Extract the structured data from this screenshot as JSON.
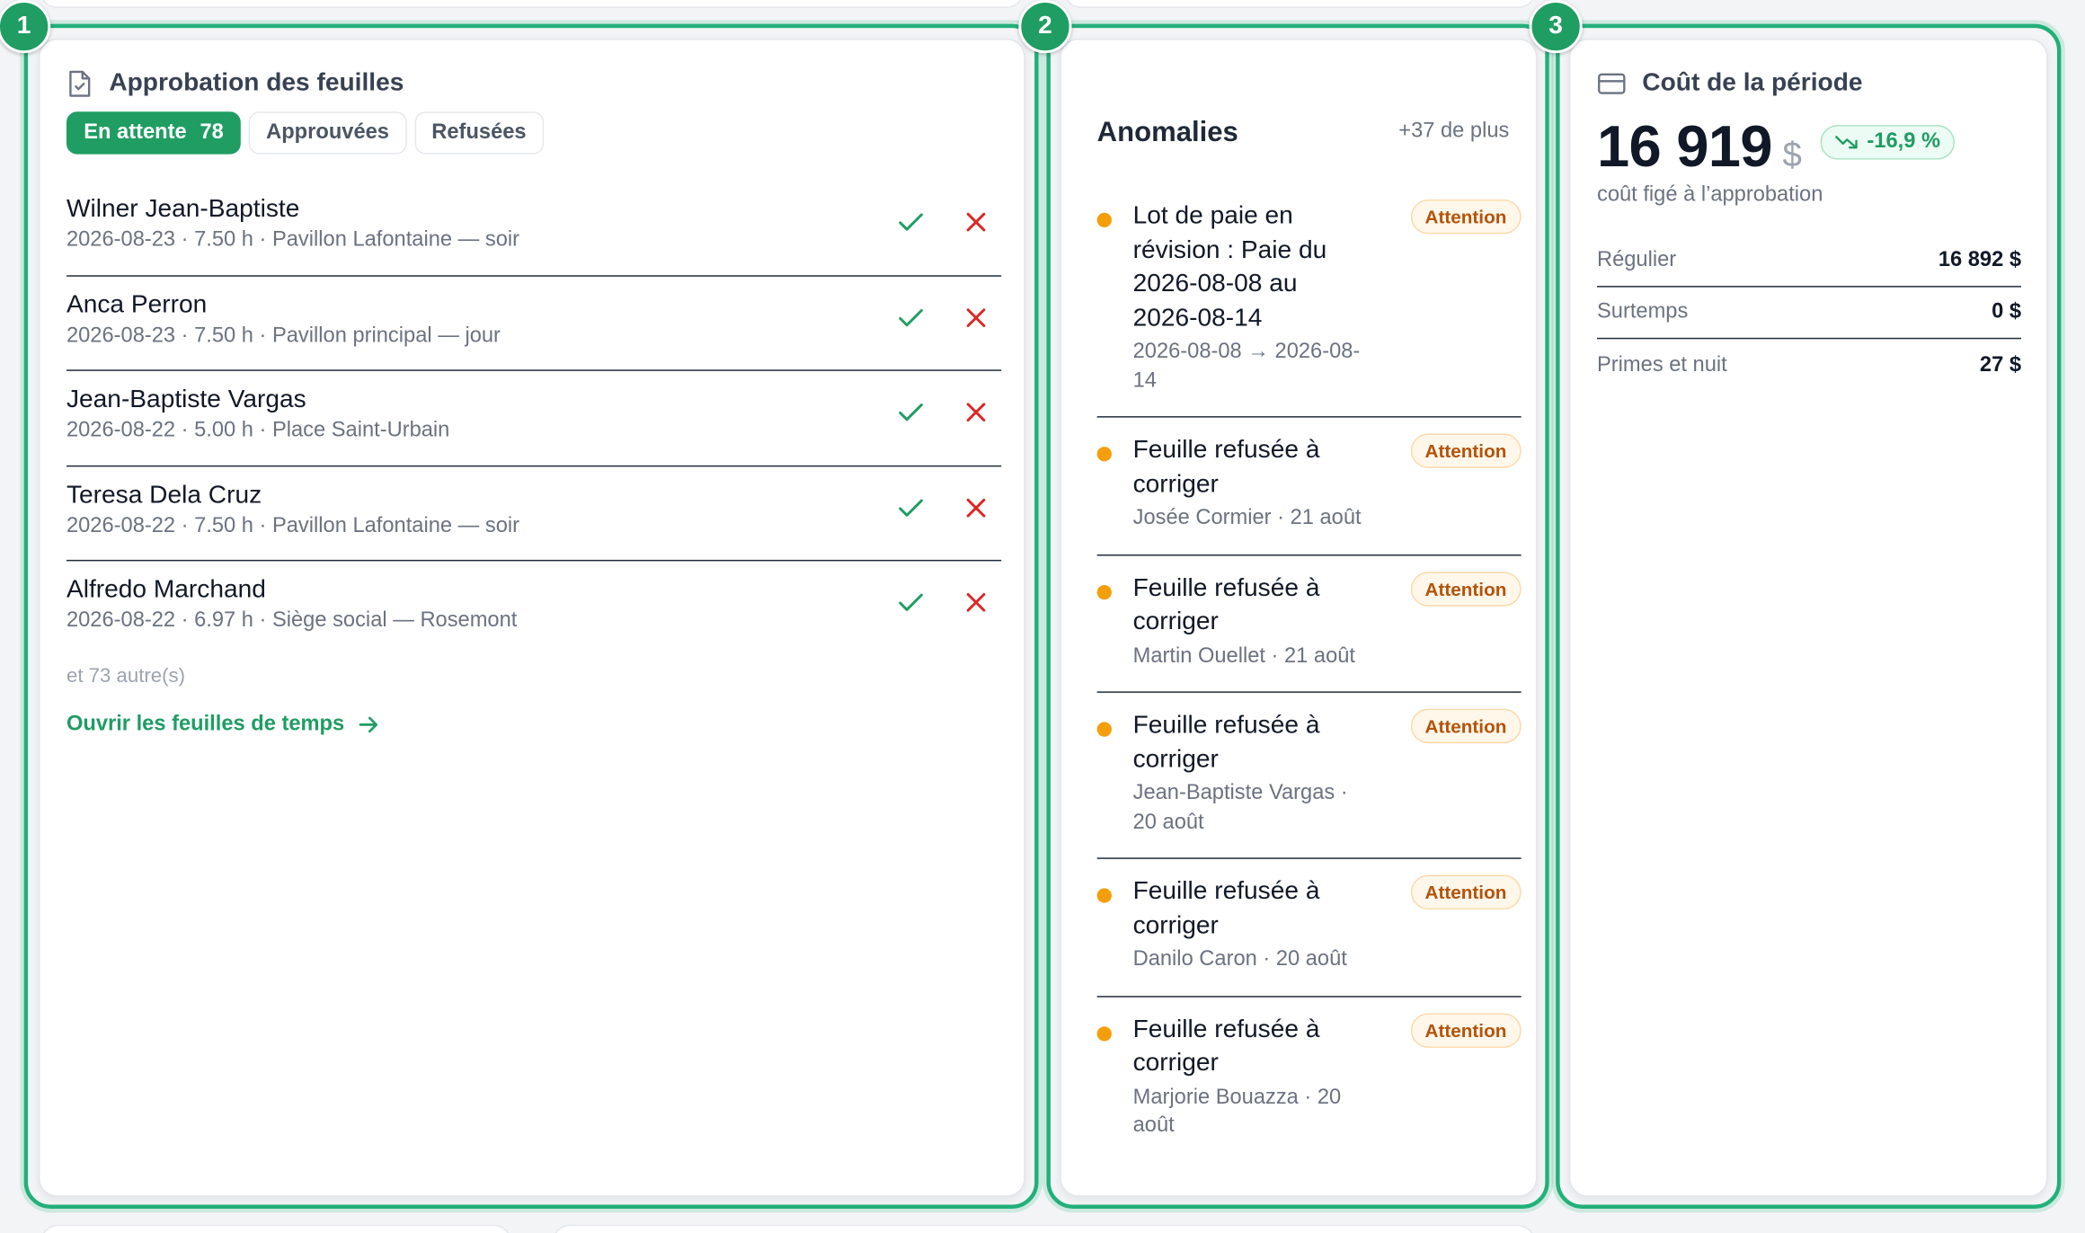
{
  "steps": [
    "1",
    "2",
    "3"
  ],
  "approvals": {
    "title": "Approbation des feuilles",
    "tabs": [
      {
        "label": "En attente",
        "count": "78"
      },
      {
        "label": "Approuvées"
      },
      {
        "label": "Refusées"
      }
    ],
    "rows": [
      {
        "name": "Wilner Jean-Baptiste",
        "meta": "2026-08-23 · 7.50 h · Pavillon Lafontaine — soir"
      },
      {
        "name": "Anca Perron",
        "meta": "2026-08-23 · 7.50 h · Pavillon principal — jour"
      },
      {
        "name": "Jean-Baptiste Vargas",
        "meta": "2026-08-22 · 5.00 h · Place Saint-Urbain"
      },
      {
        "name": "Teresa Dela Cruz",
        "meta": "2026-08-22 · 7.50 h · Pavillon Lafontaine — soir"
      },
      {
        "name": "Alfredo Marchand",
        "meta": "2026-08-22 · 6.97 h · Siège social — Rosemont"
      }
    ],
    "others": "et 73 autre(s)",
    "open_link": "Ouvrir les feuilles de temps"
  },
  "anomalies": {
    "title": "Anomalies",
    "more": "+37 de plus",
    "items": [
      {
        "title": "Lot de paie en révision : Paie du 2026-08-08 au 2026-08-14",
        "sub": "2026-08-08 → 2026-08-14",
        "badge": "Attention"
      },
      {
        "title": "Feuille refusée à corriger",
        "sub": "Josée Cormier · 21 août",
        "badge": "Attention"
      },
      {
        "title": "Feuille refusée à corriger",
        "sub": "Martin Ouellet · 21 août",
        "badge": "Attention"
      },
      {
        "title": "Feuille refusée à corriger",
        "sub": "Jean-Baptiste Vargas · 20 août",
        "badge": "Attention"
      },
      {
        "title": "Feuille refusée à corriger",
        "sub": "Danilo Caron · 20 août",
        "badge": "Attention"
      },
      {
        "title": "Feuille refusée à corriger",
        "sub": "Marjorie Bouazza · 20 août",
        "badge": "Attention"
      }
    ]
  },
  "cost": {
    "title": "Coût de la période",
    "amount": "16 919",
    "currency": "$",
    "delta": "-16,9 %",
    "note": "coût figé à l’approbation",
    "rows": [
      {
        "label": "Régulier",
        "value": "16 892 $"
      },
      {
        "label": "Surtemps",
        "value": "0 $"
      },
      {
        "label": "Primes et nuit",
        "value": "27 $"
      }
    ]
  },
  "colors": {
    "accent": "#1f9d63",
    "highlight": "#22b07a",
    "warning": "#f59e0b",
    "danger": "#dc2626"
  }
}
